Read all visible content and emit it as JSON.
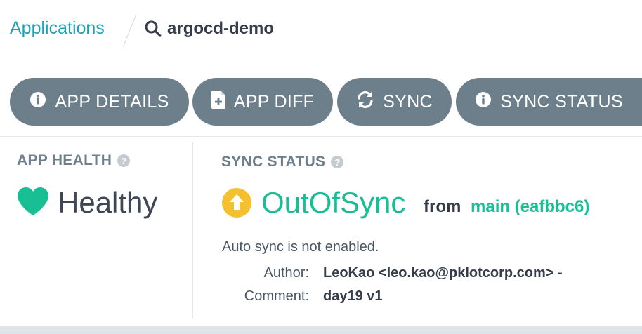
{
  "breadcrumb": {
    "root_label": "Applications",
    "current_label": "argocd-demo"
  },
  "toolbar": {
    "app_details_label": "APP DETAILS",
    "app_diff_label": "APP DIFF",
    "sync_label": "SYNC",
    "sync_status_label": "SYNC STATUS"
  },
  "health": {
    "title": "APP HEALTH",
    "help": "?",
    "status": "Healthy",
    "color": "#18be94"
  },
  "sync": {
    "title": "SYNC STATUS",
    "help": "?",
    "status": "OutOfSync",
    "from_label": "from",
    "revision": "main (eafbbc6)",
    "status_color": "#18be94",
    "icon_color": "#f4c030",
    "auto_sync_text": "Auto sync is not enabled.",
    "author_label": "Author:",
    "author_value": "LeoKao <leo.kao@pklotcorp.com> -",
    "comment_label": "Comment:",
    "comment_value": "day19 v1"
  },
  "icons": {
    "breadcrumb": "search-icon",
    "app_details": "info-circle-icon",
    "app_diff": "file-plus-icon",
    "sync": "sync-arrows-icon",
    "sync_status": "info-circle-icon",
    "health": "heart-icon",
    "sync_state": "arrow-up-circle-icon"
  }
}
